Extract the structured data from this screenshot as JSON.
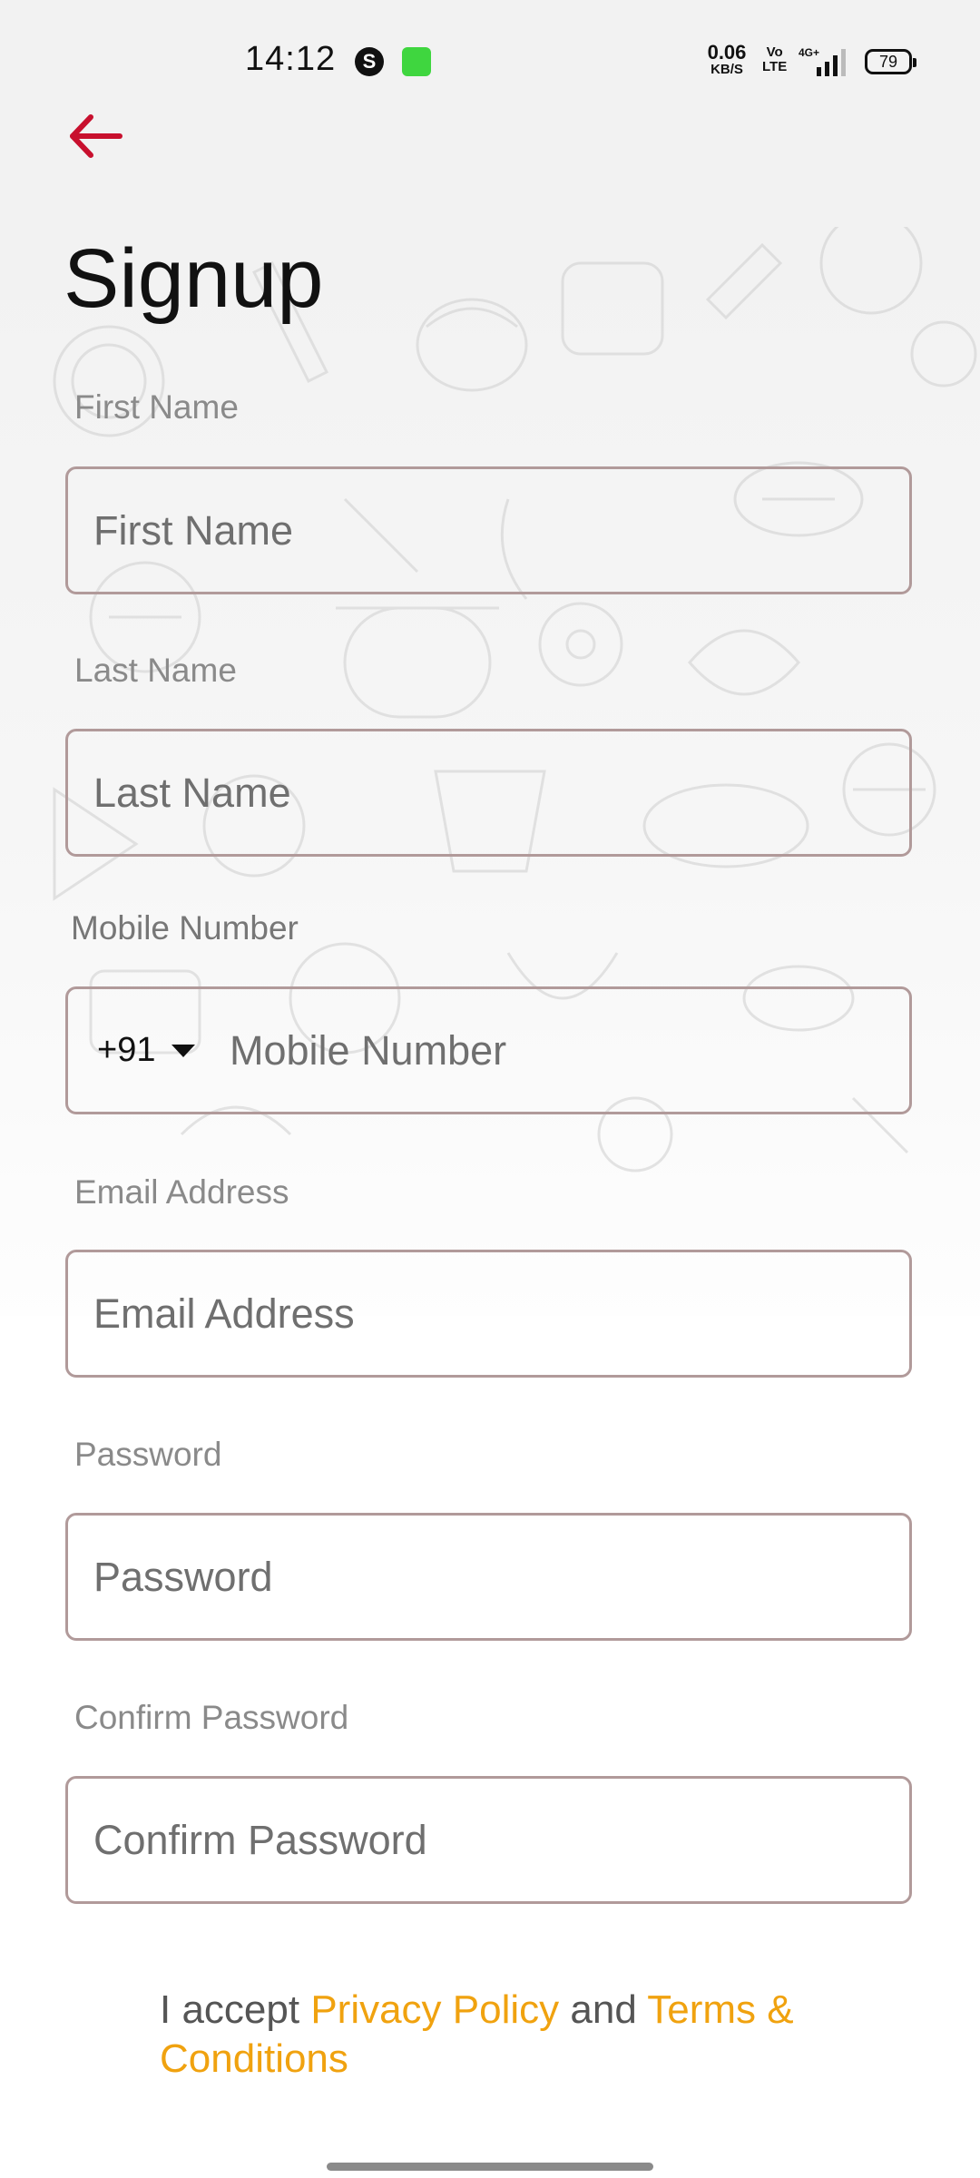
{
  "status_bar": {
    "time": "14:12",
    "speed_value": "0.06",
    "speed_unit": "KB/S",
    "volte_top": "Vo",
    "volte_bottom": "LTE",
    "network": "4G+",
    "battery": "79"
  },
  "header": {
    "back_icon": "arrow-left-icon",
    "title": "Signup"
  },
  "form": {
    "first_name": {
      "label": "First Name",
      "placeholder": "First Name",
      "value": ""
    },
    "last_name": {
      "label": "Last Name",
      "placeholder": "Last Name",
      "value": ""
    },
    "mobile": {
      "label": "Mobile Number",
      "country_code": "+91",
      "placeholder": "Mobile Number",
      "value": ""
    },
    "email": {
      "label": "Email Address",
      "placeholder": "Email Address",
      "value": ""
    },
    "password": {
      "label": "Password",
      "placeholder": "Password",
      "value": ""
    },
    "confirm_password": {
      "label": "Confirm Password",
      "placeholder": "Confirm Password",
      "value": ""
    }
  },
  "terms": {
    "prefix": "I accept ",
    "privacy_link": "Privacy Policy",
    "connector": " and ",
    "terms_link": "Terms & Conditions"
  },
  "colors": {
    "accent_red": "#c8102e",
    "link_orange": "#f0a20f",
    "field_border": "#b19a9a"
  }
}
